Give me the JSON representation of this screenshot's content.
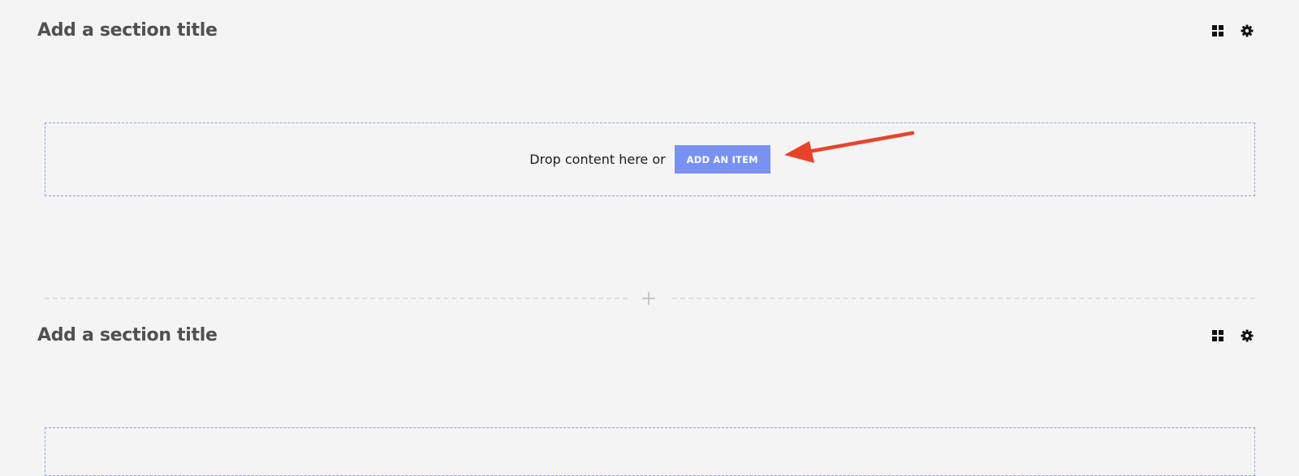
{
  "sections": [
    {
      "title": "Add a section title",
      "drop_text": "Drop content here or",
      "add_button": "ADD AN ITEM"
    },
    {
      "title": "Add a section title"
    }
  ],
  "icons": {
    "layout": "grid-icon",
    "settings": "gear-icon",
    "add_section": "plus-icon"
  },
  "colors": {
    "background": "#f4f4f4",
    "accent": "#7a91f4",
    "drop_border": "#8aa2f3",
    "title": "#505050",
    "annotation_arrow": "#e8432a"
  }
}
